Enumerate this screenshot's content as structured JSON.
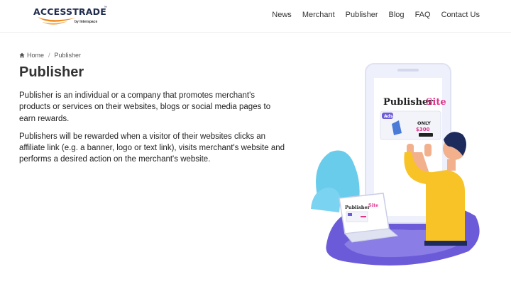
{
  "brand": {
    "name": "ACCESSTRADE",
    "tagline": "by Interspace",
    "colors": {
      "navy": "#1f2c4d",
      "orange": "#f08c1e"
    }
  },
  "nav": {
    "items": [
      {
        "label": "News"
      },
      {
        "label": "Merchant"
      },
      {
        "label": "Publisher"
      },
      {
        "label": "Blog"
      },
      {
        "label": "FAQ"
      },
      {
        "label": "Contact Us"
      }
    ]
  },
  "breadcrumb": {
    "home": "Home",
    "current": "Publisher"
  },
  "page": {
    "title": "Publisher",
    "paragraphs": [
      "Publisher is an individual or a company that promotes merchant's products or services on their websites, blogs or social media pages to earn rewards.",
      "Publishers will be rewarded when a visitor of their websites clicks an affiliate link (e.g. a banner, logo or text link), visits merchant's website and performs a desired action on the merchant's website."
    ]
  },
  "illustration": {
    "phone_title_a": "Publisher",
    "phone_title_b": "Site",
    "ads_badge": "Ads",
    "offer_line1": "ONLY",
    "offer_price": "$300",
    "laptop_title_a": "Publisher",
    "laptop_title_b": "Site",
    "colors": {
      "yellow": "#f7c326",
      "purple": "#6b5bd8",
      "cyan": "#4fc3e8",
      "pink": "#e0338a"
    }
  }
}
